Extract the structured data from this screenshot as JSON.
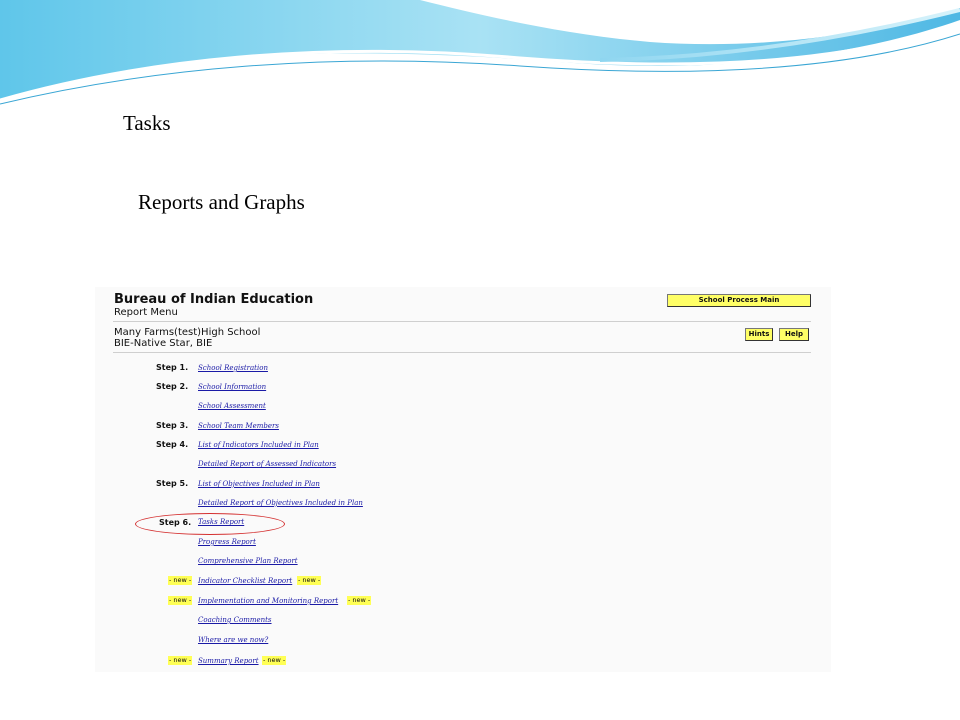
{
  "slide": {
    "headings": [
      "Tasks",
      "Reports and Graphs"
    ]
  },
  "screenshot": {
    "title": "Bureau of Indian Education",
    "subtitle": "Report Menu",
    "school_name": "Many Farms(test)High School",
    "school_subtitle": "BIE-Native Star, BIE",
    "buttons": {
      "main": "School Process Main",
      "hints": "Hints",
      "help": "Help"
    },
    "steps": [
      "Step 1.",
      "Step 2.",
      "Step 3.",
      "Step 4.",
      "Step 5.",
      "Step 6."
    ],
    "new_tag": "- new -",
    "links": {
      "school_registration": "School Registration",
      "school_information": "School Information",
      "school_assessment": "School Assessment",
      "school_team_members": "School Team Members",
      "list_indicators": "List of Indicators Included in Plan",
      "detailed_assessed_indicators": "Detailed Report of Assessed Indicators",
      "list_objectives": "List of Objectives Included in Plan",
      "detailed_objectives": "Detailed Report of Objectives Included in Plan",
      "tasks_report": "Tasks Report",
      "progress_report": "Progress Report",
      "comprehensive_plan": "Comprehensive Plan Report",
      "indicator_checklist": "Indicator Checklist Report",
      "implementation_monitoring": "Implementation and Monitoring Report",
      "coaching_comments": "Coaching Comments",
      "where_are_we_now": "Where are we now?",
      "summary_report": "Summary Report"
    },
    "colors": {
      "button_bg": "#ffff66",
      "link": "#1a1aa6",
      "highlight_circle": "#d43030",
      "new_tag_bg": "#ffff55"
    }
  }
}
